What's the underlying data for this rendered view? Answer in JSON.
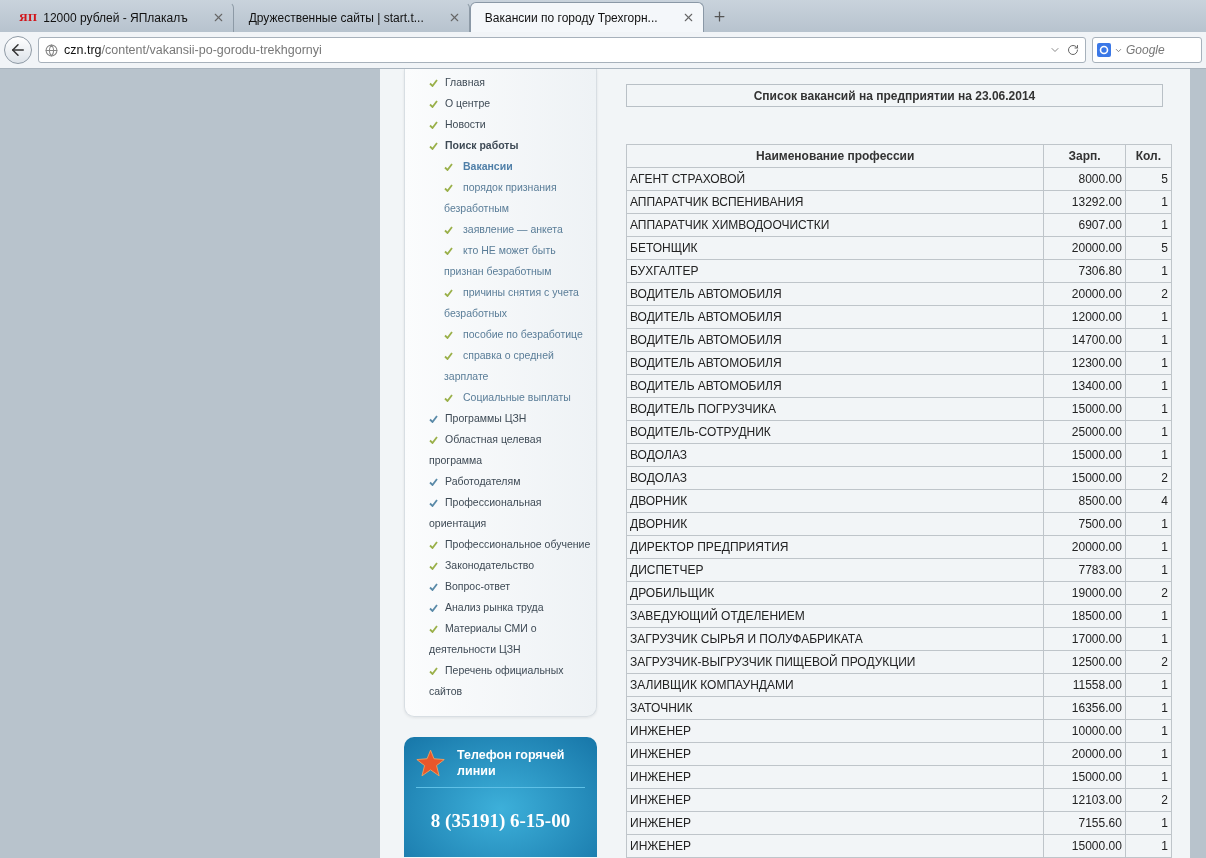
{
  "browser": {
    "tabs": [
      {
        "icon_text": "ЯП",
        "title": "12000 рублей - ЯПлакалъ",
        "selected": false
      },
      {
        "title": "Дружественные сайты | start.t...",
        "selected": false
      },
      {
        "title": "Вакансии по городу Трехгорн...",
        "selected": true
      }
    ],
    "address": {
      "host": "czn.trg",
      "path": "/content/vakansii-po-gorodu-trekhgornyi"
    },
    "search": {
      "placeholder": "Google"
    }
  },
  "sidebar": {
    "items": [
      {
        "label": "Главная",
        "selected": false,
        "color": "#9ab04a"
      },
      {
        "label": "О центре",
        "selected": false,
        "color": "#9ab04a"
      },
      {
        "label": "Новости",
        "selected": false,
        "color": "#9ab04a"
      },
      {
        "label": "Поиск работы",
        "selected": false,
        "color": "#9ab04a",
        "children": [
          {
            "label": "Вакансии",
            "selected": true,
            "color": "#9ab04a"
          },
          {
            "label": "порядок признания безработным",
            "selected": false,
            "color": "#9ab04a"
          },
          {
            "label": "заявление — анкета",
            "selected": false,
            "color": "#9ab04a"
          },
          {
            "label": "кто НЕ может быть признан безработным",
            "selected": false,
            "color": "#9ab04a"
          },
          {
            "label": "причины снятия с учета безработных",
            "selected": false,
            "color": "#9ab04a"
          },
          {
            "label": "пособие по безработице",
            "selected": false,
            "color": "#9ab04a"
          },
          {
            "label": "справка о средней зарплате",
            "selected": false,
            "color": "#9ab04a"
          },
          {
            "label": "Социальные выплаты",
            "selected": false,
            "color": "#9ab04a"
          }
        ]
      },
      {
        "label": "Программы ЦЗН",
        "selected": false,
        "color": "#5a8aa8"
      },
      {
        "label": "Областная целевая программа",
        "selected": false,
        "color": "#9ab04a"
      },
      {
        "label": "Работодателям",
        "selected": false,
        "color": "#5a8aa8"
      },
      {
        "label": "Профессиональная ориентация",
        "selected": false,
        "color": "#5a8aa8"
      },
      {
        "label": "Профессиональное обучение",
        "selected": false,
        "color": "#9ab04a"
      },
      {
        "label": "Законодательство",
        "selected": false,
        "color": "#9ab04a"
      },
      {
        "label": "Вопрос-ответ",
        "selected": false,
        "color": "#5a8aa8"
      },
      {
        "label": "Анализ рынка труда",
        "selected": false,
        "color": "#5a8aa8"
      },
      {
        "label": "Материалы СМИ о деятельности ЦЗН",
        "selected": false,
        "color": "#9ab04a"
      },
      {
        "label": "Перечень официальных сайтов",
        "selected": false,
        "color": "#9ab04a"
      }
    ]
  },
  "hotline": {
    "title": "Телефон горячей линии",
    "phone": "8 (35191) 6-15-00"
  },
  "content": {
    "title": "Список вакансий на предприятии на 23.06.2014",
    "table": {
      "columns": [
        "Наименование профессии",
        "Зарп.",
        "Кол."
      ],
      "rows": [
        [
          "АГЕНТ СТРАХОВОЙ",
          "8000.00",
          "5"
        ],
        [
          "АППАРАТЧИК ВСПЕНИВАНИЯ",
          "13292.00",
          "1"
        ],
        [
          "АППАРАТЧИК ХИМВОДООЧИСТКИ",
          "6907.00",
          "1"
        ],
        [
          "БЕТОНЩИК",
          "20000.00",
          "5"
        ],
        [
          "БУХГАЛТЕР",
          "7306.80",
          "1"
        ],
        [
          "ВОДИТЕЛЬ АВТОМОБИЛЯ",
          "20000.00",
          "2"
        ],
        [
          "ВОДИТЕЛЬ АВТОМОБИЛЯ",
          "12000.00",
          "1"
        ],
        [
          "ВОДИТЕЛЬ АВТОМОБИЛЯ",
          "14700.00",
          "1"
        ],
        [
          "ВОДИТЕЛЬ АВТОМОБИЛЯ",
          "12300.00",
          "1"
        ],
        [
          "ВОДИТЕЛЬ АВТОМОБИЛЯ",
          "13400.00",
          "1"
        ],
        [
          "ВОДИТЕЛЬ ПОГРУЗЧИКА",
          "15000.00",
          "1"
        ],
        [
          "ВОДИТЕЛЬ-СОТРУДНИК",
          "25000.00",
          "1"
        ],
        [
          "ВОДОЛАЗ",
          "15000.00",
          "1"
        ],
        [
          "ВОДОЛАЗ",
          "15000.00",
          "2"
        ],
        [
          "ДВОРНИК",
          "8500.00",
          "4"
        ],
        [
          "ДВОРНИК",
          "7500.00",
          "1"
        ],
        [
          "ДИРЕКТОР ПРЕДПРИЯТИЯ",
          "20000.00",
          "1"
        ],
        [
          "ДИСПЕТЧЕР",
          "7783.00",
          "1"
        ],
        [
          "ДРОБИЛЬЩИК",
          "19000.00",
          "2"
        ],
        [
          "ЗАВЕДУЮЩИЙ ОТДЕЛЕНИЕМ",
          "18500.00",
          "1"
        ],
        [
          "ЗАГРУЗЧИК СЫРЬЯ И ПОЛУФАБРИКАТА",
          "17000.00",
          "1"
        ],
        [
          "ЗАГРУЗЧИК-ВЫГРУЗЧИК ПИЩЕВОЙ ПРОДУКЦИИ",
          "12500.00",
          "2"
        ],
        [
          "ЗАЛИВЩИК КОМПАУНДАМИ",
          "11558.00",
          "1"
        ],
        [
          "ЗАТОЧНИК",
          "16356.00",
          "1"
        ],
        [
          "ИНЖЕНЕР",
          "10000.00",
          "1"
        ],
        [
          "ИНЖЕНЕР",
          "20000.00",
          "1"
        ],
        [
          "ИНЖЕНЕР",
          "15000.00",
          "1"
        ],
        [
          "ИНЖЕНЕР",
          "12103.00",
          "2"
        ],
        [
          "ИНЖЕНЕР",
          "7155.60",
          "1"
        ],
        [
          "ИНЖЕНЕР",
          "15000.00",
          "1"
        ]
      ]
    }
  }
}
